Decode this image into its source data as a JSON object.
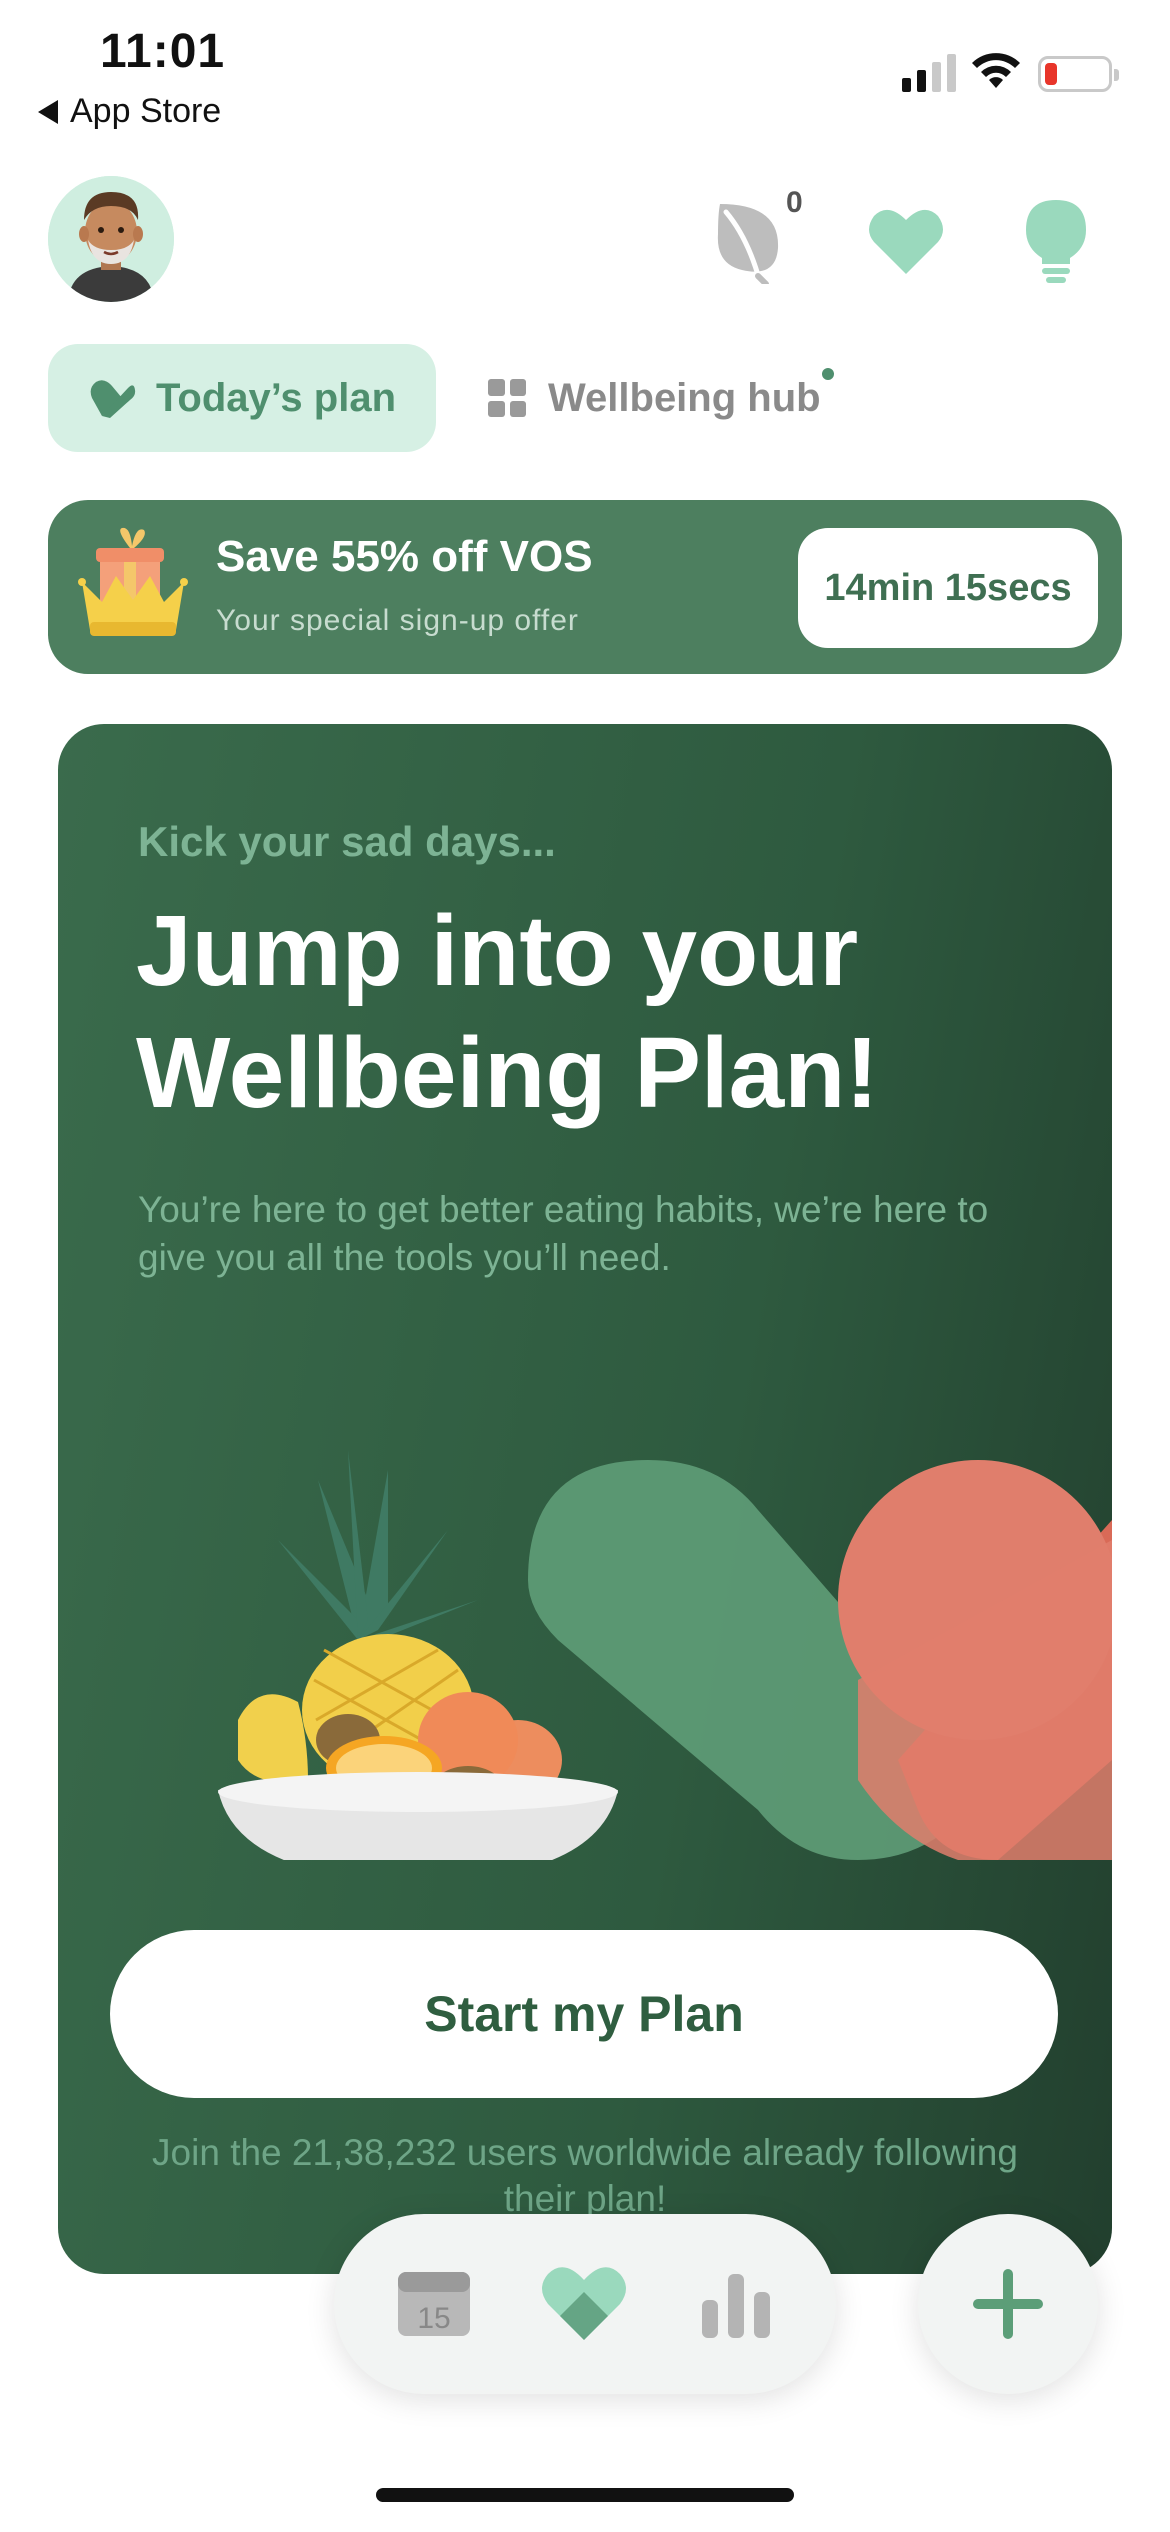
{
  "status_bar": {
    "time": "11:01",
    "back_label": "App Store"
  },
  "header": {
    "leaf_count": "0",
    "icons": [
      "avatar",
      "leaf-icon",
      "heart-icon",
      "lightbulb-icon"
    ]
  },
  "tabs": [
    {
      "label": "Today’s plan",
      "active": true,
      "icon": "heart-check-icon"
    },
    {
      "label": "Wellbeing hub",
      "active": false,
      "icon": "grid-icon"
    }
  ],
  "offer": {
    "title": "Save 55% off VOS",
    "subtitle": "Your special sign-up offer",
    "timer": "14min 15secs",
    "icon": "gift-crown-icon"
  },
  "plan_card": {
    "kicker": "Kick your sad days...",
    "headline": "Jump into your Wellbeing Plan!",
    "blurb": "You’re here to get better eating habits, we’re here to give you all the tools you’ll need.",
    "button_label": "Start my Plan",
    "join_text": "Join the 21,38,232 users worldwide already following their plan!"
  },
  "bottom_nav": {
    "calendar_day": "15",
    "items": [
      "calendar-icon",
      "heart-icon",
      "stats-icon"
    ],
    "fab_icon": "plus-icon"
  },
  "colors": {
    "brand_green": "#4d7f5f",
    "card_green": "#2e5a3f",
    "mint": "#d6f0e4",
    "accent_mint": "#9ad9bd",
    "coral": "#e07e6c"
  }
}
